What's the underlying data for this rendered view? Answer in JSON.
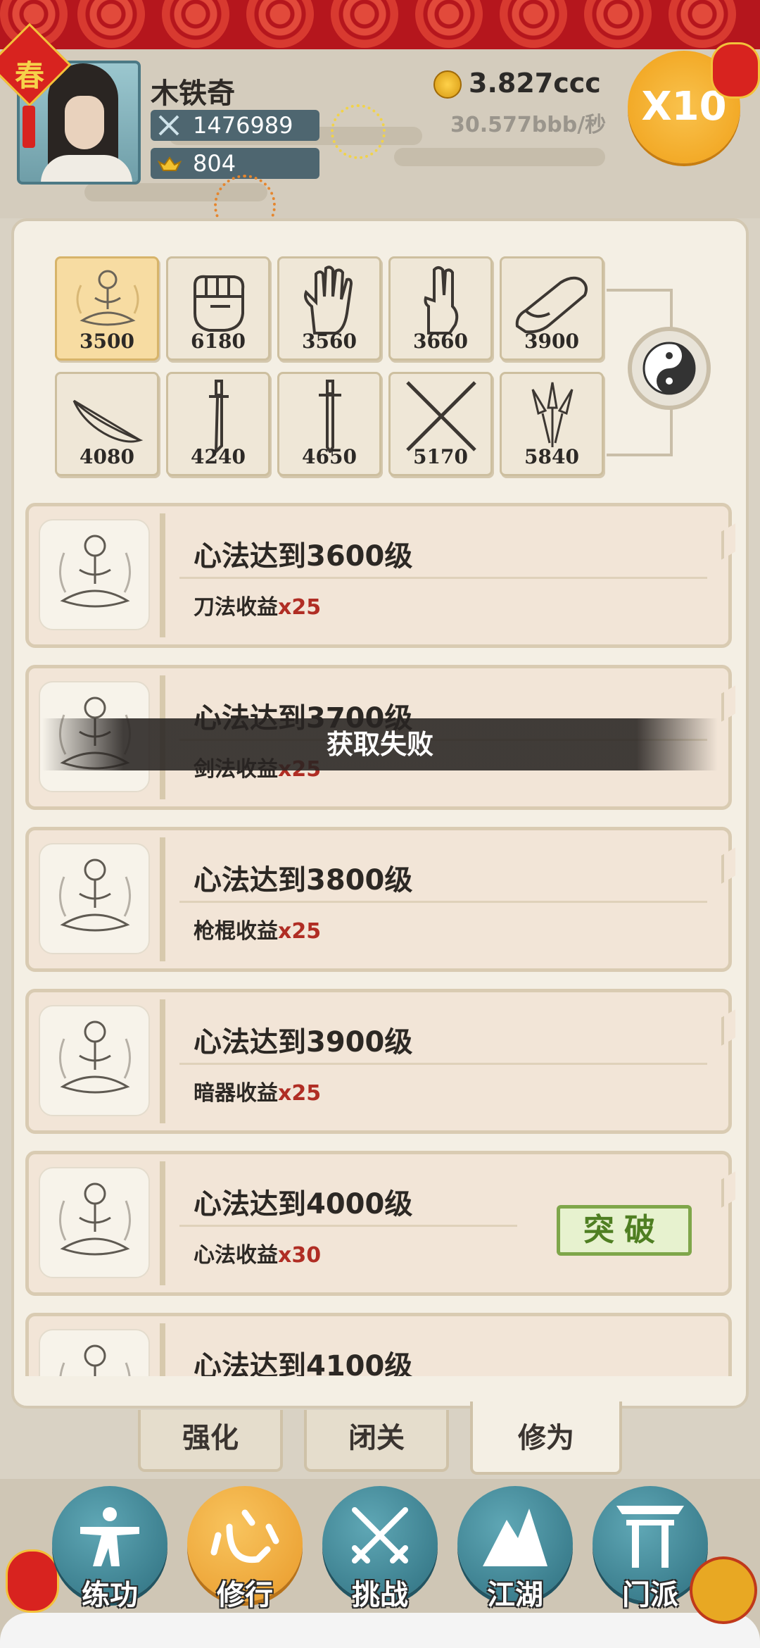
{
  "header": {
    "spring_char": "春",
    "player_name": "木铁奇",
    "power": "1476989",
    "ingots": "804",
    "gold_amount": "3.827ccc",
    "gold_rate": "30.577bbb/秒",
    "speed_label": "X10"
  },
  "skills": [
    {
      "icon": "meditation-icon",
      "level": "3500",
      "selected": true
    },
    {
      "icon": "fist-icon",
      "level": "6180"
    },
    {
      "icon": "palm-icon",
      "level": "3560"
    },
    {
      "icon": "two-finger-icon",
      "level": "3660"
    },
    {
      "icon": "shoe-icon",
      "level": "3900"
    },
    {
      "icon": "feather-icon",
      "level": "4080"
    },
    {
      "icon": "saber-icon",
      "level": "4240"
    },
    {
      "icon": "sword-icon",
      "level": "4650"
    },
    {
      "icon": "crossed-staffs-icon",
      "level": "5170"
    },
    {
      "icon": "throwing-knives-icon",
      "level": "5840"
    }
  ],
  "tasks": [
    {
      "goal": "心法达到3600级",
      "reward": "刀法收益",
      "mult": "x25"
    },
    {
      "goal": "心法达到3700级",
      "reward": "剑法收益",
      "mult": "x25"
    },
    {
      "goal": "心法达到3800级",
      "reward": "枪棍收益",
      "mult": "x25"
    },
    {
      "goal": "心法达到3900级",
      "reward": "暗器收益",
      "mult": "x25"
    },
    {
      "goal": "心法达到4000级",
      "reward": "心法收益",
      "mult": "x30",
      "button": "突破"
    },
    {
      "goal": "心法达到4100级",
      "reward": "",
      "mult": ""
    }
  ],
  "toast": "获取失败",
  "sub_tabs": [
    "强化",
    "闭关",
    "修为"
  ],
  "nav": [
    "练功",
    "修行",
    "挑战",
    "江湖",
    "门派"
  ],
  "colors": {
    "accent_red": "#b5161d",
    "multiplier": "#b02d24",
    "nav_teal": "#2e6f7f",
    "nav_active": "#e99a2a",
    "break_green": "#4f7f22"
  }
}
